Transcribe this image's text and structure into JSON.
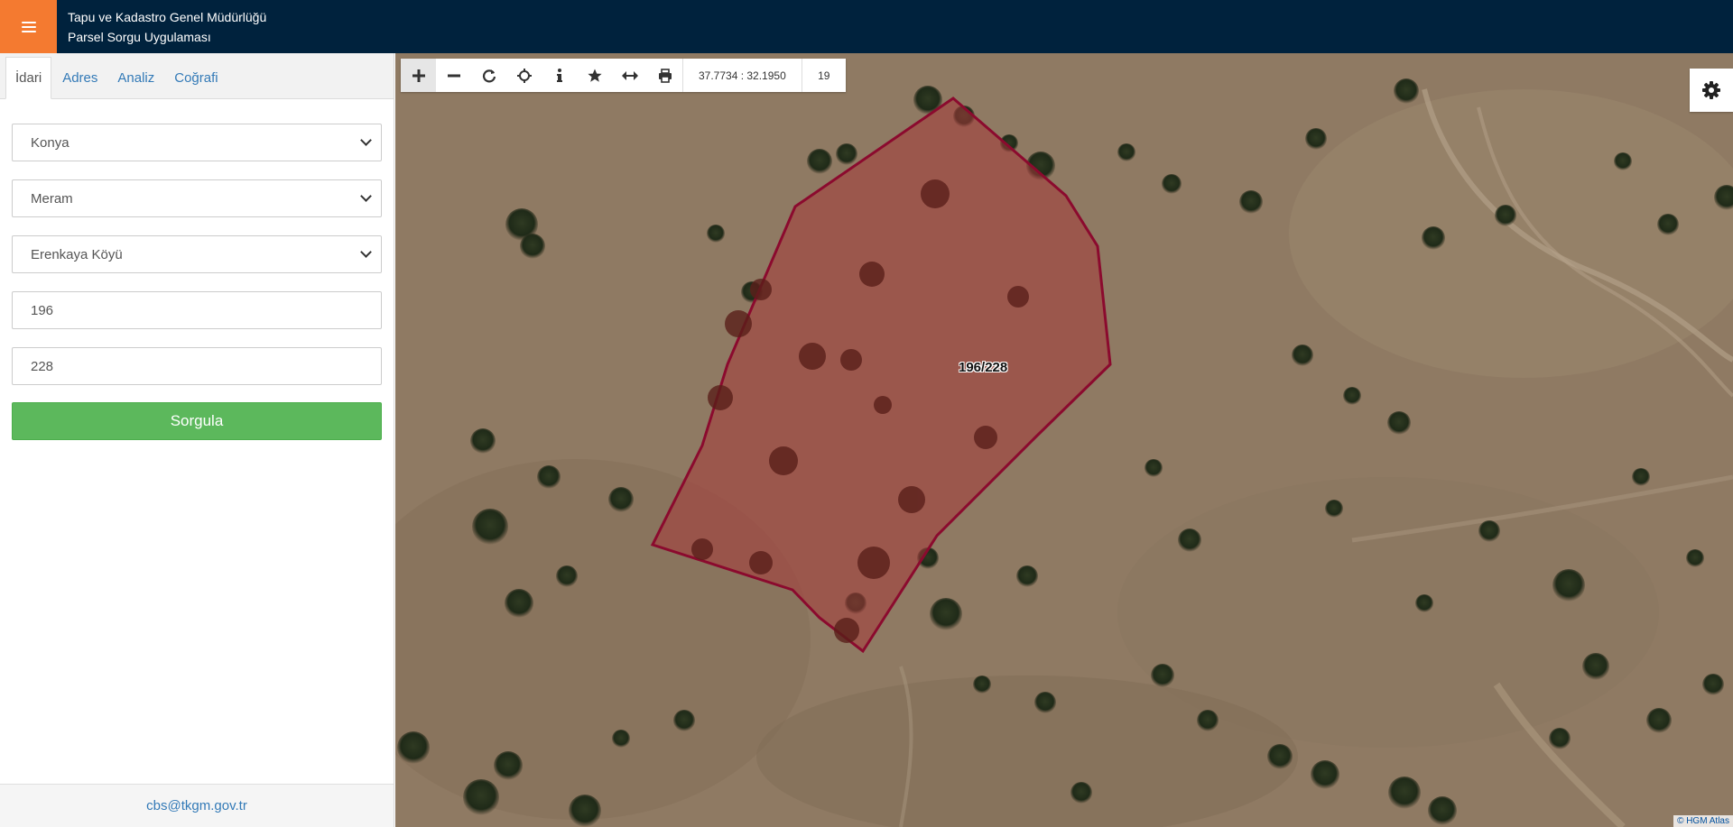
{
  "header": {
    "title_line1": "Tapu ve Kadastro Genel Müdürlüğü",
    "title_line2": "Parsel Sorgu Uygulaması",
    "menu_icon": "hamburger-menu-icon",
    "accent_color": "#f47a30",
    "bar_color": "#00223d"
  },
  "sidebar": {
    "tabs": [
      {
        "label": "İdari",
        "active": true
      },
      {
        "label": "Adres",
        "active": false
      },
      {
        "label": "Analiz",
        "active": false
      },
      {
        "label": "Coğrafi",
        "active": false
      }
    ],
    "form": {
      "province": "Konya",
      "district": "Meram",
      "neighborhood": "Erenkaya Köyü",
      "block_no": "196",
      "parcel_no": "228",
      "submit_label": "Sorgula"
    },
    "footer_email": "cbs@tkgm.gov.tr",
    "button_color": "#5cb85c"
  },
  "map": {
    "toolbar_icons": [
      "zoom-in-icon",
      "zoom-out-icon",
      "refresh-icon",
      "locate-icon",
      "info-icon",
      "star-icon",
      "measure-icon",
      "print-icon"
    ],
    "coordinates": "37.7734 : 32.1950",
    "zoom_level": "19",
    "parcel_label": "196/228",
    "parcel_outline_color": "#8b0a2e",
    "settings_icon": "gear-icon",
    "attribution": "© HGM Atlas"
  }
}
